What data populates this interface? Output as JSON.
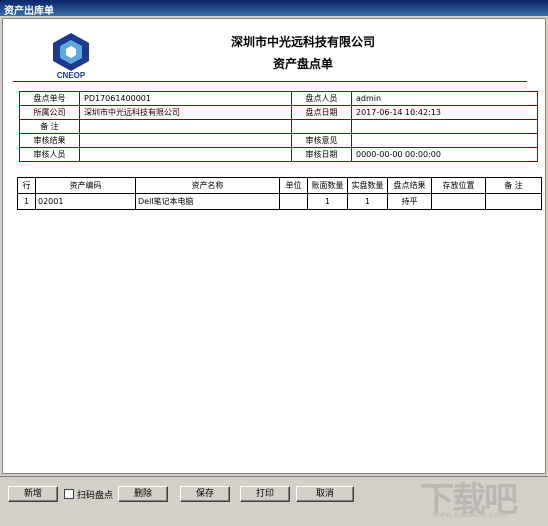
{
  "window": {
    "title": "资产出库单"
  },
  "doc": {
    "logo_text": "CNEOP",
    "company": "深圳市中光远科技有限公司",
    "title": "资产盘点单"
  },
  "info": {
    "rows": [
      {
        "l1": "盘点单号",
        "v1": "PD17061400001",
        "l2": "盘点人员",
        "v2": "admin"
      },
      {
        "l1": "所属公司",
        "v1": "深圳市中光远科技有限公司",
        "l2": "盘点日期",
        "v2": "2017-06-14 10:42:13"
      },
      {
        "l1": "备 注",
        "v1": "",
        "l2": "",
        "v2": ""
      },
      {
        "l1": "审核结果",
        "v1": "",
        "l2": "审核意见",
        "v2": ""
      },
      {
        "l1": "审核人员",
        "v1": "",
        "l2": "审核日期",
        "v2": "0000-00-00 00:00:00"
      }
    ]
  },
  "grid": {
    "headers": [
      "行",
      "资产编码",
      "资产名称",
      "单位",
      "账面数量",
      "实盘数量",
      "盘点结果",
      "存放位置",
      "备 注"
    ],
    "rows": [
      [
        "1",
        "02001",
        "Dell笔记本电脑",
        "",
        "1",
        "1",
        "持平",
        "",
        ""
      ]
    ]
  },
  "buttons": {
    "add": "新增",
    "scan_label": "扫码盘点",
    "delete": "删除",
    "save": "保存",
    "print": "打印",
    "cancel": "取消"
  },
  "watermark": {
    "text": "下载吧",
    "sub": "www.xiazaiba.com"
  }
}
